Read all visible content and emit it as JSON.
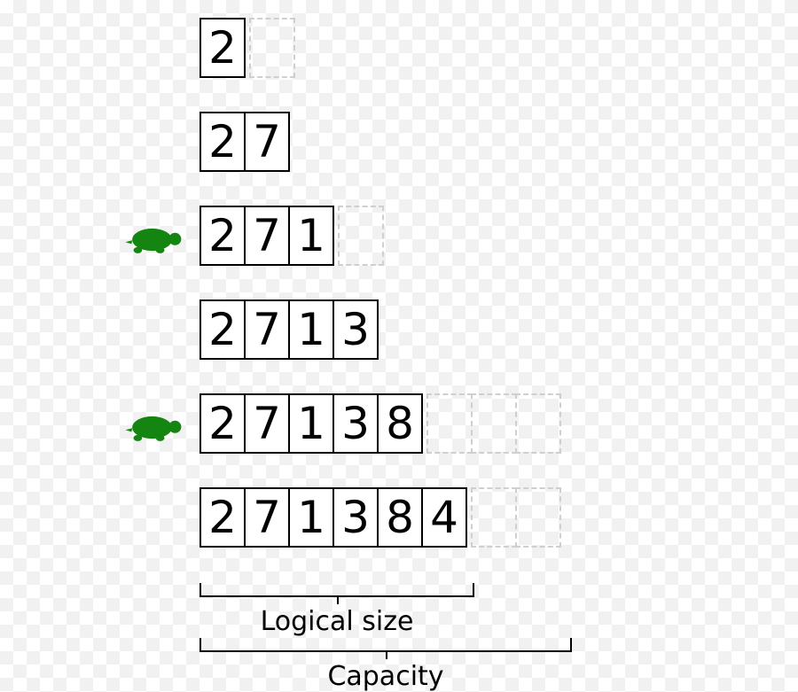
{
  "diagram": {
    "rows": [
      {
        "filled": [
          "2"
        ],
        "empty": 1,
        "turtle": false
      },
      {
        "filled": [
          "2",
          "7"
        ],
        "empty": 0,
        "turtle": false
      },
      {
        "filled": [
          "2",
          "7",
          "1"
        ],
        "empty": 1,
        "turtle": true
      },
      {
        "filled": [
          "2",
          "7",
          "1",
          "3"
        ],
        "empty": 0,
        "turtle": false
      },
      {
        "filled": [
          "2",
          "7",
          "1",
          "3",
          "8"
        ],
        "empty": 3,
        "turtle": true
      },
      {
        "filled": [
          "2",
          "7",
          "1",
          "3",
          "8",
          "4"
        ],
        "empty": 2,
        "turtle": false
      }
    ],
    "labels": {
      "logical_size": "Logical size",
      "capacity": "Capacity"
    },
    "turtle_color": "#138510"
  }
}
